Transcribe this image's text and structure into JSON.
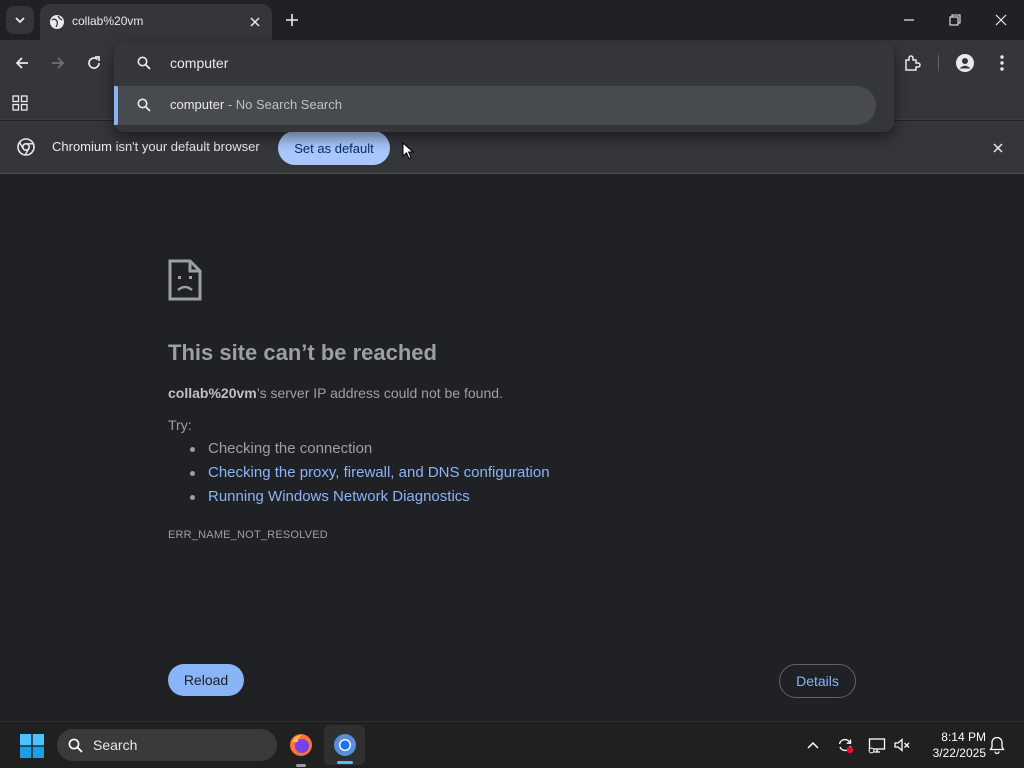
{
  "tab": {
    "title": "collab%20vm"
  },
  "omnibox": {
    "value": "computer",
    "suggestion_query": "computer",
    "suggestion_suffix": " - No Search Search"
  },
  "infobar": {
    "message": "Chromium isn't your default browser",
    "button": "Set as default"
  },
  "error": {
    "title": "This site can’t be reached",
    "host": "collab%20vm",
    "description_suffix": "’s server IP address could not be found.",
    "try_label": "Try:",
    "suggestions": [
      "Checking the connection",
      "Checking the proxy, firewall, and DNS configuration",
      "Running Windows Network Diagnostics"
    ],
    "code": "ERR_NAME_NOT_RESOLVED",
    "reload": "Reload",
    "details": "Details"
  },
  "taskbar": {
    "search": "Search",
    "time": "8:14 PM",
    "date": "3/22/2025"
  },
  "colors": {
    "accent": "#8ab4f8",
    "background": "#202124",
    "toolbar": "#35363a"
  }
}
